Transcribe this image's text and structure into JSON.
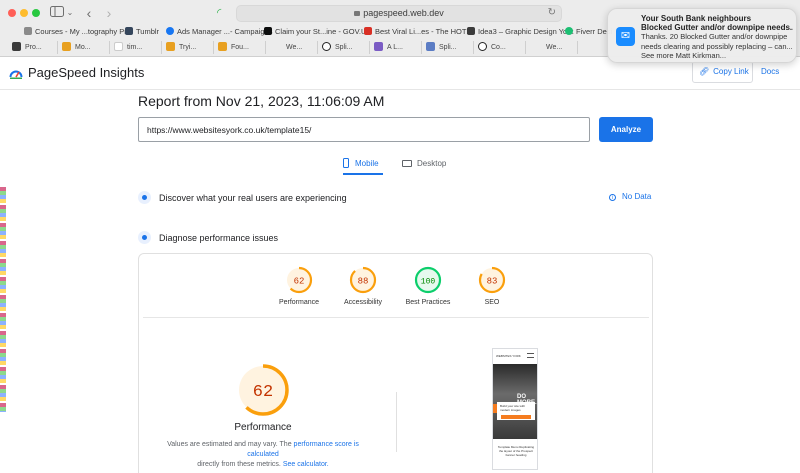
{
  "browser": {
    "address": "pagespeed.web.dev",
    "bookmarks": [
      {
        "label": "Courses - My ...tography Pro",
        "color": "#8a8a8a"
      },
      {
        "label": "Tumblr",
        "color": "#35465c"
      },
      {
        "label": "Ads Manager ...- Campaigns",
        "color": "#1877f2"
      },
      {
        "label": "Claim your St...ine - GOV.UK",
        "color": "#0b0c0c"
      },
      {
        "label": "Best Viral Li...es - The HOTH",
        "color": "#d93025"
      },
      {
        "label": "Idea3 – Graphic Design York",
        "color": "#3b3b3b"
      },
      {
        "label": "Fiverr Desi",
        "color": "#1dbf73"
      }
    ],
    "tabs": [
      "Pro...",
      "Mo...",
      "tim...",
      "Tryi...",
      "Fou...",
      "We...",
      "Spli...",
      "A L...",
      "Spli...",
      "Co...",
      "We..."
    ]
  },
  "notification": {
    "title": "Your South Bank neighbours",
    "subtitle": "Blocked Gutter and/or downpipe needs...",
    "body": "Thanks. 20 Blocked Gutter and/or downpipe needs clearing and possibly replacing – can... See more Matt Kirkman..."
  },
  "header": {
    "title": "PageSpeed Insights",
    "copy_link": "Copy Link",
    "docs": "Docs"
  },
  "report": {
    "title": "Report from Nov 21, 2023, 11:06:09 AM",
    "url": "https://www.websitesyork.co.uk/template15/",
    "analyze": "Analyze"
  },
  "device_tabs": {
    "mobile": "Mobile",
    "desktop": "Desktop"
  },
  "sections": {
    "real_users": "Discover what your real users are experiencing",
    "no_data": "No Data",
    "diagnose": "Diagnose performance issues"
  },
  "scores": [
    {
      "label": "Performance",
      "value": 62,
      "color": "#fa9f0c",
      "bg": "#fff3e0"
    },
    {
      "label": "Accessibility",
      "value": 88,
      "color": "#fa9f0c",
      "bg": "#fff3e0"
    },
    {
      "label": "Best Practices",
      "value": 100,
      "color": "#0cce6b",
      "bg": "#e6f9ee"
    },
    {
      "label": "SEO",
      "value": 83,
      "color": "#fa9f0c",
      "bg": "#fff3e0"
    }
  ],
  "performance": {
    "value": 62,
    "label": "Performance",
    "note_prefix": "Values are estimated and may vary. The",
    "note_link1": "performance score is calculated",
    "note_mid": "directly from these metrics.",
    "note_link2": "See calculator."
  },
  "preview": {
    "site": "WEBSITES YORK",
    "hero_text": "DO MORE.",
    "box_text": "Build your site with modern images",
    "footer_text": "Template Menu Replicating the layout of the Prospect banner heading"
  }
}
